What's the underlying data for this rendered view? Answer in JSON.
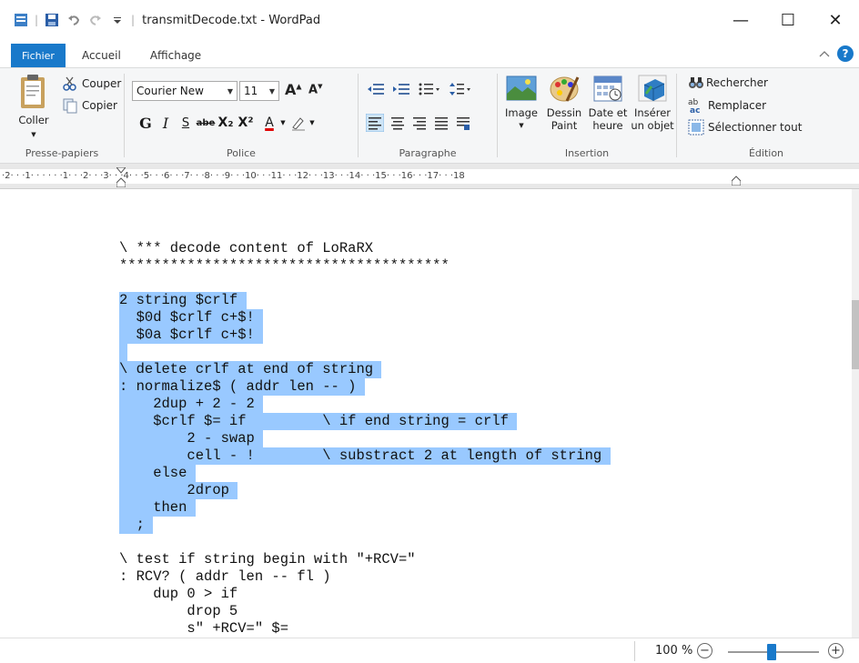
{
  "window": {
    "title": "transmitDecode.txt - WordPad",
    "qa_separator": "|",
    "min": "—",
    "max": "☐",
    "close": "✕"
  },
  "tabs": [
    {
      "label": "Fichier"
    },
    {
      "label": "Accueil"
    },
    {
      "label": "Affichage"
    }
  ],
  "ribbon": {
    "clipboard": {
      "paste": "Coller",
      "cut": "Couper",
      "copy": "Copier",
      "label": "Presse-papiers"
    },
    "font": {
      "family": "Courier New",
      "size": "11",
      "label": "Police",
      "bold": "G",
      "italic": "I",
      "underline": "S",
      "strike": "abe",
      "sub": "X₂",
      "sup": "X²",
      "color": "A"
    },
    "paragraph": {
      "label": "Paragraphe"
    },
    "insert": {
      "image": "Image",
      "paint": "Dessin\nPaint",
      "datetime": "Date et\nheure",
      "object": "Insérer\nun objet",
      "label": "Insertion"
    },
    "edit": {
      "find": "Rechercher",
      "replace": "Remplacer",
      "selectall": "Sélectionner tout",
      "label": "Édition"
    }
  },
  "ruler": "·2·  ·  ·1·  ·  · ·  ·  ·1·  ·  ·2·  ·  ·3·  ·  ·4·  ·  ·5·  ·  ·6·  ·  ·7·  ·  ·8·  ·  ·9·  ·  ·10·  ·  ·11·  ·  ·12·  ·  ·13·  ·  ·14·  ·  ·15·  ·  ·16·  ·  ·17·  ·  ·18",
  "document": {
    "lines": [
      {
        "text": "\\ *** decode content of LoRaRX",
        "selected": false
      },
      {
        "text": "***************************************",
        "selected": false
      },
      {
        "text": "",
        "selected": false
      },
      {
        "text": "2 string $crlf ",
        "selected": true
      },
      {
        "text": "  $0d $crlf c+$! ",
        "selected": true
      },
      {
        "text": "  $0a $crlf c+$! ",
        "selected": true
      },
      {
        "text": " ",
        "selected": true
      },
      {
        "text": "\\ delete crlf at end of string ",
        "selected": true
      },
      {
        "text": ": normalize$ ( addr len -- ) ",
        "selected": true
      },
      {
        "text": "    2dup + 2 - 2 ",
        "selected": true
      },
      {
        "text": "    $crlf $= if         \\ if end string = crlf ",
        "selected": true
      },
      {
        "text": "        2 - swap ",
        "selected": true
      },
      {
        "text": "        cell - !        \\ substract 2 at length of string ",
        "selected": true
      },
      {
        "text": "    else ",
        "selected": true
      },
      {
        "text": "        2drop ",
        "selected": true
      },
      {
        "text": "    then ",
        "selected": true
      },
      {
        "text": "  ; ",
        "selected": true
      },
      {
        "text": "",
        "selected": false
      },
      {
        "text": "\\ test if string begin with \"+RCV=\"",
        "selected": false
      },
      {
        "text": ": RCV? ( addr len -- fl )",
        "selected": false
      },
      {
        "text": "    dup 0 > if",
        "selected": false
      },
      {
        "text": "        drop 5",
        "selected": false
      },
      {
        "text": "        s\" +RCV=\" $=",
        "selected": false
      }
    ]
  },
  "status": {
    "zoom": "100 %",
    "zoom_out": "−",
    "zoom_in": "+"
  }
}
